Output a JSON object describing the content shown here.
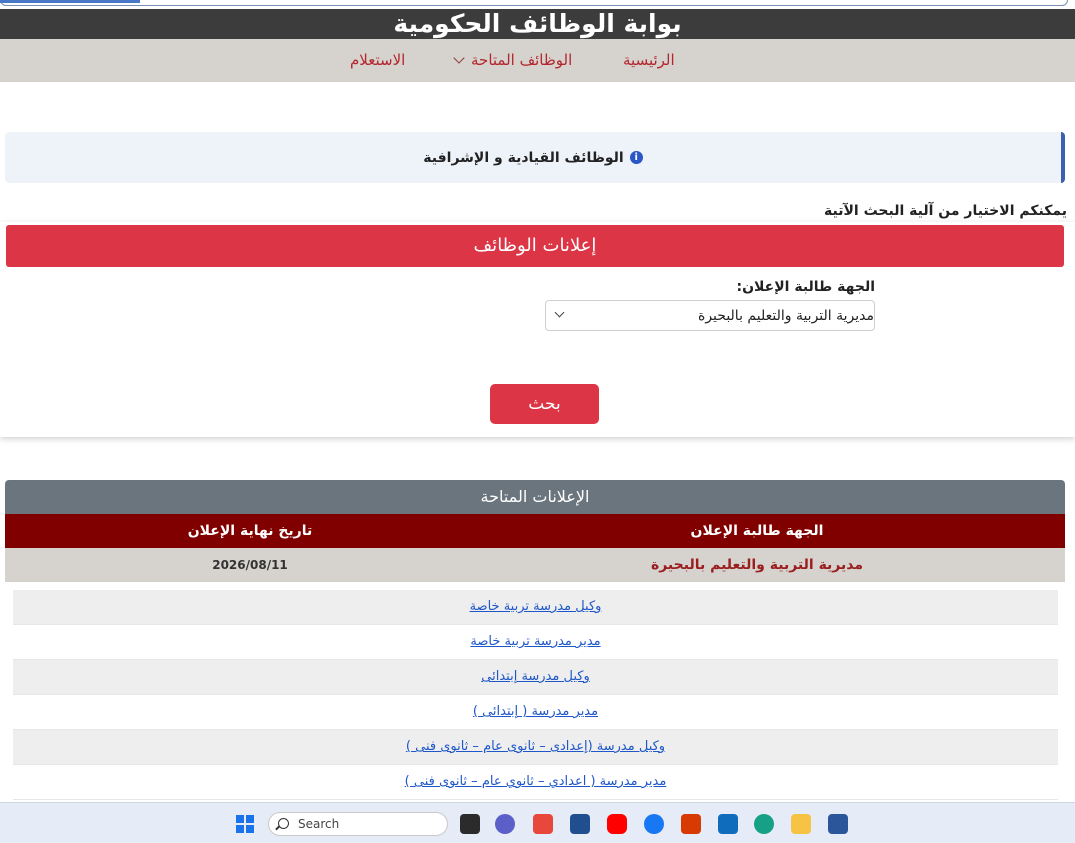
{
  "header": {
    "title": "بوابة الوظائف الحكومية"
  },
  "nav": {
    "home": "الرئيسية",
    "available_jobs": "الوظائف المتاحة",
    "inquiry": "الاستعلام"
  },
  "leadership": {
    "label": "الوظائف القيادية و الإشرافية"
  },
  "search_hint": "يمكنكم الاختيار من آلية البحث الآتية",
  "ads_card": {
    "title": "إعلانات الوظائف",
    "field_label": "الجهة طالبة الإعلان:",
    "selected_org": "مديرية التربية والتعليم بالبحيرة",
    "search_button": "بحث"
  },
  "results": {
    "title": "الإعلانات المتاحة",
    "col_org": "الجهة طالبة الإعلان",
    "col_end_date": "تاريخ نهاية الإعلان",
    "org_name": "مديرية التربية والتعليم بالبحيرة",
    "end_date": "2026/08/11",
    "jobs": [
      "وكيل مدرسة تربية خاصة",
      "مدير مدرسة تربية خاصة",
      "وكيل مدرسة إبتدائى",
      "مدير مدرسة ( إبتدائى )",
      "وكيل مدرسة (إعدادى – ثانوى عام – ثانوى فنى )",
      "مدير مدرسة ( اعدادي – ثانوي عام – ثانوى فنى )"
    ]
  },
  "taskbar": {
    "search_placeholder": "Search"
  },
  "colors": {
    "title_bar": "#3c3c3c",
    "nav_bar": "#d6d2ce",
    "nav_text": "#b3262e",
    "primary_red": "#dc3545",
    "maroon": "#800000",
    "gray_header": "#6b757d",
    "link": "#1f57c8"
  }
}
